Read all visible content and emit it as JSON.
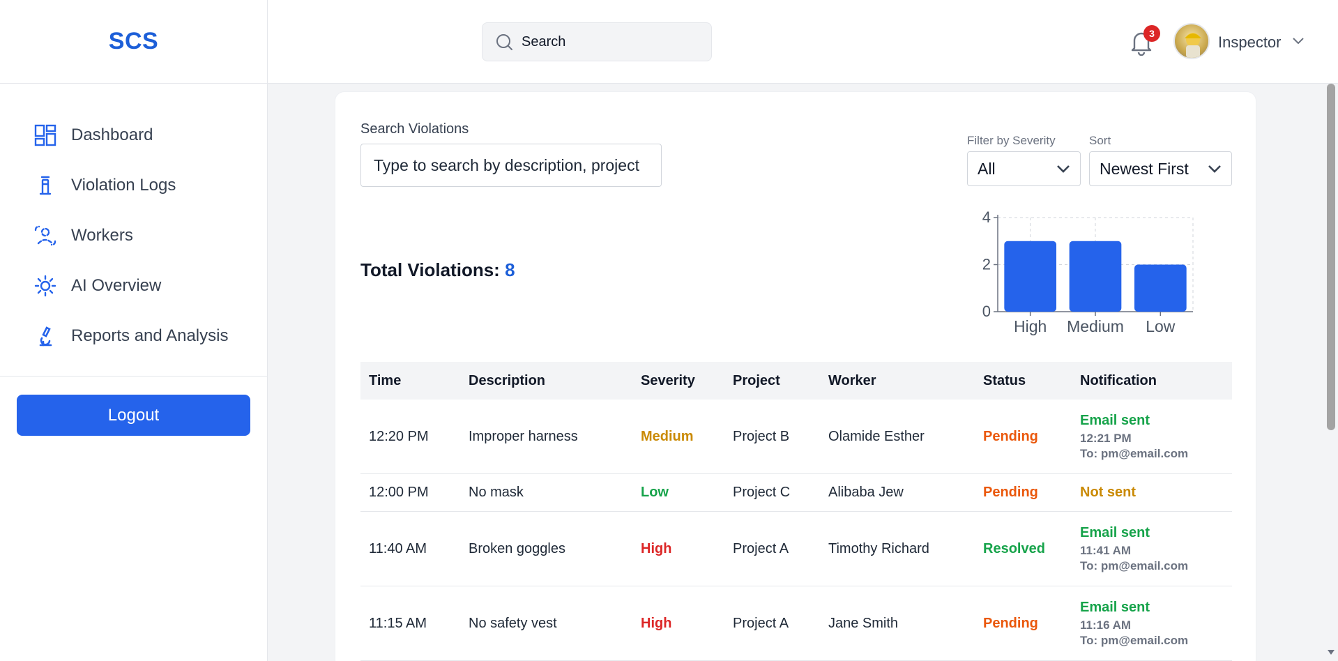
{
  "brand": "SCS",
  "sidebar": {
    "items": [
      {
        "label": "Dashboard",
        "icon": "dashboard-grid-icon"
      },
      {
        "label": "Violation Logs",
        "icon": "violation-log-icon"
      },
      {
        "label": "Workers",
        "icon": "workers-icon"
      },
      {
        "label": "AI Overview",
        "icon": "sun-icon"
      },
      {
        "label": "Reports and Analysis",
        "icon": "microscope-icon"
      }
    ],
    "logout_label": "Logout"
  },
  "header": {
    "search_placeholder": "Search",
    "notification_count": "3",
    "user_name": "Inspector"
  },
  "filters": {
    "search_label": "Search Violations",
    "search_placeholder": "Type to search by description, project",
    "severity_label": "Filter by Severity",
    "severity_value": "All",
    "sort_label": "Sort",
    "sort_value": "Newest First"
  },
  "summary": {
    "total_label": "Total Violations:",
    "total_value": "8"
  },
  "chart_data": {
    "type": "bar",
    "categories": [
      "High",
      "Medium",
      "Low"
    ],
    "values": [
      3,
      3,
      2
    ],
    "ylim": [
      0,
      4
    ],
    "yticks": [
      "0",
      "2",
      "4"
    ],
    "grid": true,
    "color": "#2563eb"
  },
  "table": {
    "headers": [
      "Time",
      "Description",
      "Severity",
      "Project",
      "Worker",
      "Status",
      "Notification"
    ],
    "rows": [
      {
        "time": "12:20 PM",
        "description": "Improper harness",
        "severity": "Medium",
        "project": "Project B",
        "worker": "Olamide Esther",
        "status": "Pending",
        "notification": "Email sent",
        "notif_time": "12:21 PM",
        "notif_to": "To: pm@email.com"
      },
      {
        "time": "12:00 PM",
        "description": "No mask",
        "severity": "Low",
        "project": "Project C",
        "worker": "Alibaba Jew",
        "status": "Pending",
        "notification": "Not sent",
        "notif_time": "",
        "notif_to": ""
      },
      {
        "time": "11:40 AM",
        "description": "Broken goggles",
        "severity": "High",
        "project": "Project A",
        "worker": "Timothy Richard",
        "status": "Resolved",
        "notification": "Email sent",
        "notif_time": "11:41 AM",
        "notif_to": "To: pm@email.com"
      },
      {
        "time": "11:15 AM",
        "description": "No safety vest",
        "severity": "High",
        "project": "Project A",
        "worker": "Jane Smith",
        "status": "Pending",
        "notification": "Email sent",
        "notif_time": "11:16 AM",
        "notif_to": "To: pm@email.com"
      }
    ]
  },
  "colors": {
    "accent": "#2563eb",
    "brand": "#1d5fd8",
    "high": "#dc2626",
    "medium": "#ca8a04",
    "low": "#16a34a",
    "pending": "#ea580c",
    "resolved": "#16a34a"
  }
}
